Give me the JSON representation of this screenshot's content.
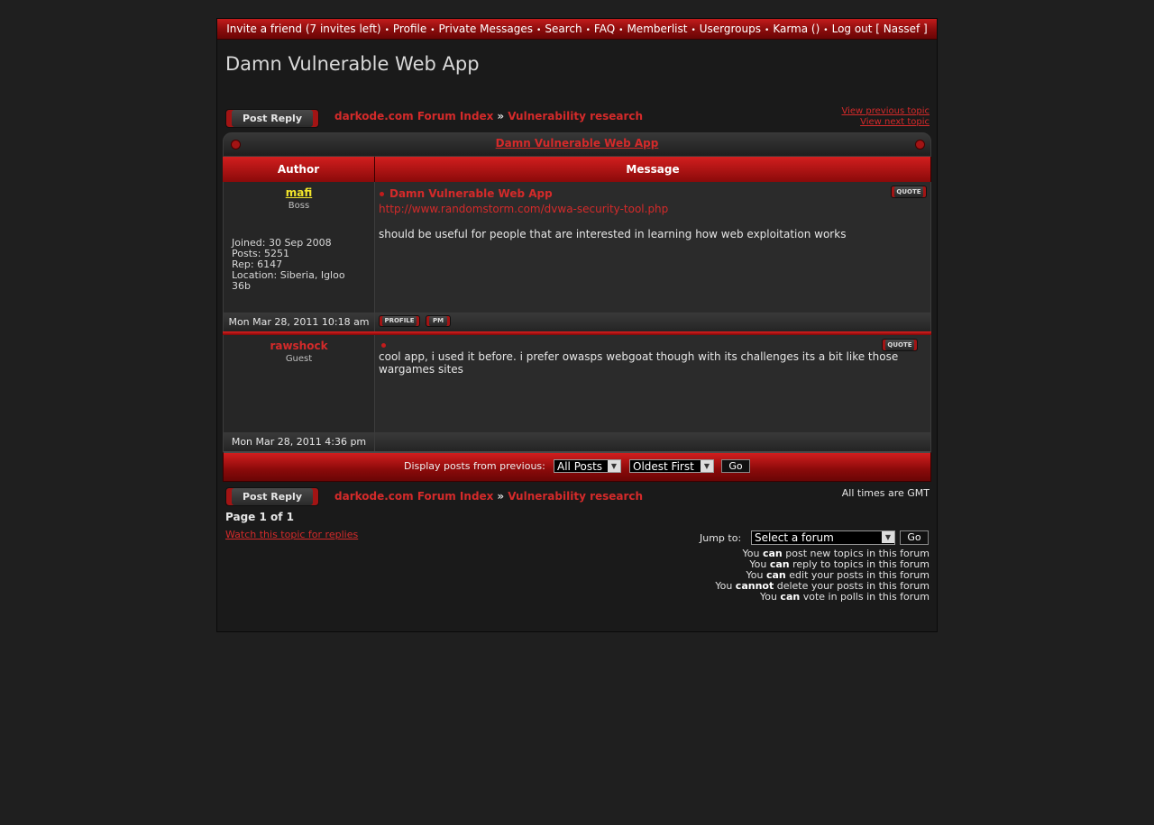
{
  "nav": {
    "items": [
      "Invite a friend (7 invites left)",
      "Profile",
      "Private Messages",
      "Search",
      "FAQ",
      "Memberlist",
      "Usergroups",
      "Karma ()",
      "Log out [ Nassef ]"
    ]
  },
  "site_title": "Damn Vulnerable Web App",
  "post_reply_label": "Post Reply",
  "breadcrumb": {
    "forum_index": "darkode.com Forum Index",
    "sep": "»",
    "forum": "Vulnerability research"
  },
  "topic_nav": {
    "prev": "View previous topic",
    "next": "View next topic"
  },
  "topic_title": "Damn Vulnerable Web App",
  "columns": {
    "author": "Author",
    "message": "Message"
  },
  "posts": [
    {
      "author": "mafi",
      "rank": "Boss",
      "joined": "Joined: 30 Sep 2008",
      "posts": "Posts: 5251",
      "rep": "Rep: 6147",
      "location": "Location: Siberia, Igloo 36b",
      "subject": "Damn Vulnerable Web App",
      "link": "http://www.randomstorm.com/dvwa-security-tool.php",
      "body": "should be useful for people that are interested in learning how web exploitation works",
      "date": "Mon Mar 28, 2011 10:18 am",
      "quote_label": "QUOTE",
      "profile_label": "PROFILE",
      "pm_label": "PM"
    },
    {
      "author": "rawshock",
      "rank": "Guest",
      "body": "cool app, i used it before. i prefer owasps webgoat though with its challenges its a bit like those wargames sites",
      "date": "Mon Mar 28, 2011 4:36 pm",
      "quote_label": "QUOTE"
    }
  ],
  "display": {
    "label": "Display posts from previous:",
    "range_value": "All Posts",
    "order_value": "Oldest First",
    "go": "Go"
  },
  "timezone": "All times are GMT",
  "pagination": "Page 1 of 1",
  "watch_link": "Watch this topic for replies",
  "jump": {
    "label": "Jump to:",
    "value": "Select a forum",
    "go": "Go"
  },
  "permissions": [
    {
      "pre": "You ",
      "bold": "can",
      "post": " post new topics in this forum"
    },
    {
      "pre": "You ",
      "bold": "can",
      "post": " reply to topics in this forum"
    },
    {
      "pre": "You ",
      "bold": "can",
      "post": " edit your posts in this forum"
    },
    {
      "pre": "You ",
      "bold": "cannot",
      "post": " delete your posts in this forum"
    },
    {
      "pre": "You ",
      "bold": "can",
      "post": " vote in polls in this forum"
    }
  ],
  "colors": {
    "accent": "#d42a2a",
    "bg": "#1f1f1f",
    "username_highlight": "#f2e52b"
  }
}
